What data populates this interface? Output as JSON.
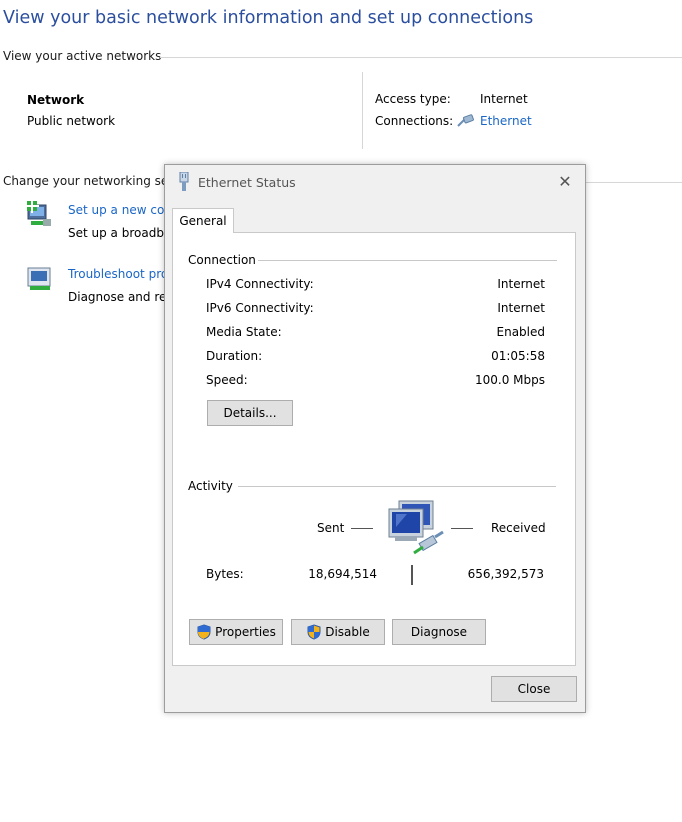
{
  "header": {
    "title": "View your basic network information and set up connections"
  },
  "active_networks": {
    "label": "View your active networks",
    "network_name": "Network",
    "network_type": "Public network",
    "access_type_label": "Access type:",
    "access_type_value": "Internet",
    "connections_label": "Connections:",
    "connections_value": "Ethernet"
  },
  "change_settings": {
    "label": "Change your networking set",
    "items": [
      {
        "link": "Set up a new co",
        "desc": "Set up a broadb"
      },
      {
        "link": "Troubleshoot pro",
        "desc": "Diagnose and re"
      }
    ]
  },
  "dialog": {
    "title": "Ethernet Status",
    "tab": "General",
    "connection_group": "Connection",
    "rows": [
      {
        "label": "IPv4 Connectivity:",
        "value": "Internet"
      },
      {
        "label": "IPv6 Connectivity:",
        "value": "Internet"
      },
      {
        "label": "Media State:",
        "value": "Enabled"
      },
      {
        "label": "Duration:",
        "value": "01:05:58"
      },
      {
        "label": "Speed:",
        "value": "100.0 Mbps"
      }
    ],
    "details_button": "Details...",
    "activity_group": "Activity",
    "sent_label": "Sent",
    "received_label": "Received",
    "bytes_label": "Bytes:",
    "bytes_sent": "18,694,514",
    "bytes_received": "656,392,573",
    "properties_button": "Properties",
    "disable_button": "Disable",
    "diagnose_button": "Diagnose",
    "close_button": "Close"
  },
  "colors": {
    "title": "#2b4f9e",
    "link": "#1a66c7",
    "dialog_bg": "#f0f0f0",
    "button_bg": "#e1e1e1"
  }
}
